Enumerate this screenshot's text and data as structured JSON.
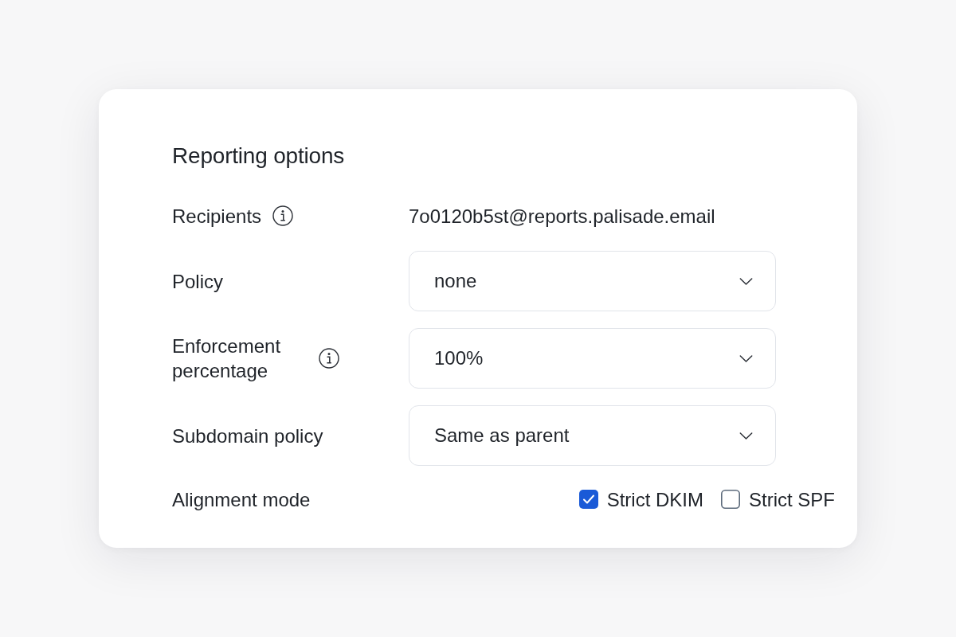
{
  "card": {
    "title": "Reporting options",
    "fields": [
      {
        "kind": "text",
        "label": "Recipients",
        "info": true,
        "value": "7o0120b5st@reports.palisade.email"
      },
      {
        "kind": "select",
        "label": "Policy",
        "info": false,
        "value": "none"
      },
      {
        "kind": "select",
        "label": "Enforcement percentage",
        "info": true,
        "value": "100%"
      },
      {
        "kind": "select",
        "label": "Subdomain policy",
        "info": false,
        "value": "Same as parent"
      },
      {
        "kind": "checkboxes",
        "label": "Alignment mode",
        "info": false,
        "options": [
          {
            "label": "Strict DKIM",
            "checked": true
          },
          {
            "label": "Strict SPF",
            "checked": false
          }
        ]
      }
    ]
  }
}
